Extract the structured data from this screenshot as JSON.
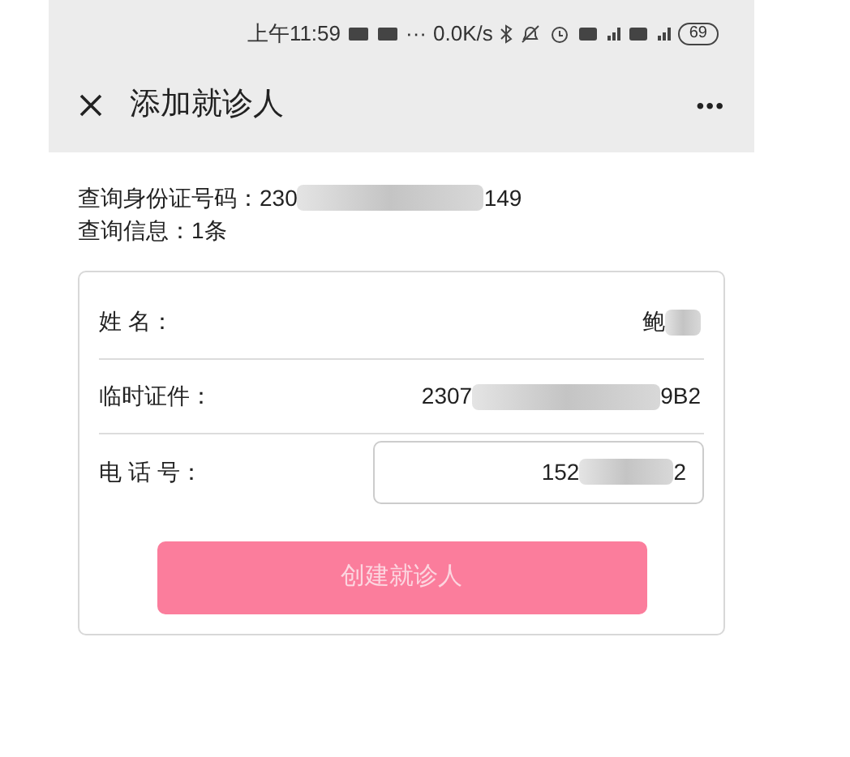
{
  "status_bar": {
    "time": "上午11:59",
    "more": "···",
    "speed": "0.0K/s",
    "battery": "69"
  },
  "header": {
    "title": "添加就诊人",
    "menu": "•••"
  },
  "query": {
    "id_label": "查询身份证号码：230",
    "id_tail": "149",
    "id_redacted": true,
    "count": "查询信息：1条"
  },
  "fields": [
    {
      "kind": "text",
      "label": "姓 名：",
      "value_head": "鲍",
      "redacted": true
    },
    {
      "kind": "text",
      "label": "临时证件：",
      "value_head": "2307",
      "value_tail": "9B2",
      "redacted": true
    },
    {
      "kind": "input",
      "label": "电 话 号：",
      "value_head": "152",
      "value_tail": "2",
      "redacted": true
    }
  ],
  "button": {
    "label": "创建就诊人",
    "disabled": true
  }
}
